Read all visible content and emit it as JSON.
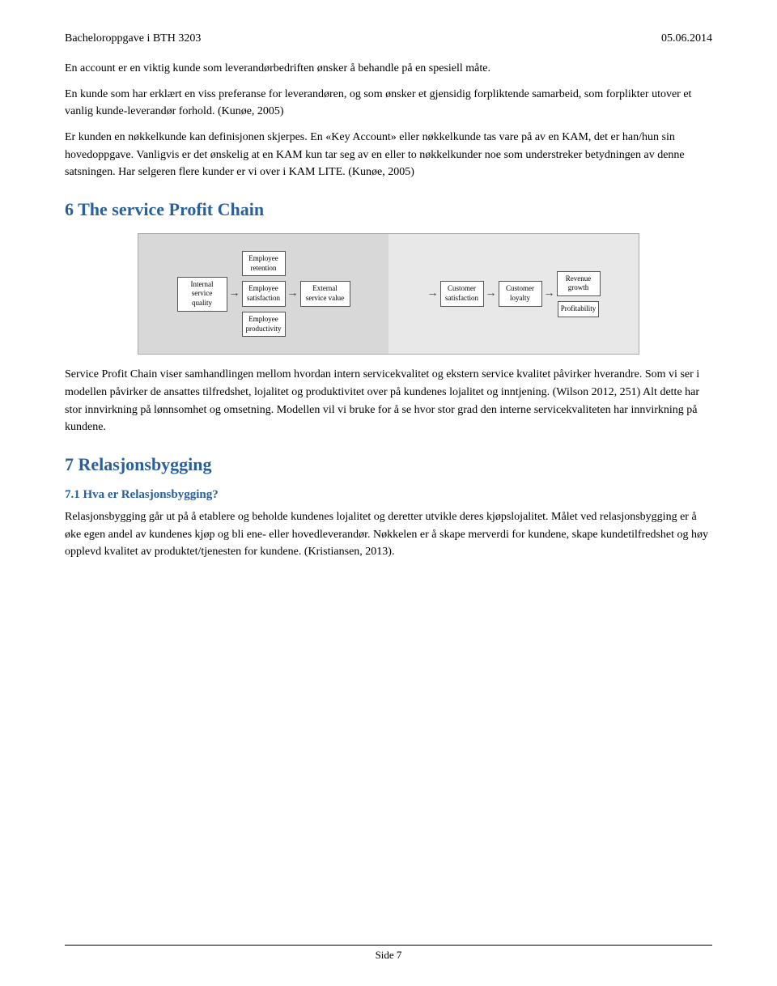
{
  "header": {
    "left": "Bacheloroppgave i BTH 3203",
    "right": "05.06.2014"
  },
  "paragraphs": {
    "p1": "En account er en viktig kunde som leverandørbedriften ønsker å behandle på en spesiell måte.",
    "p2": "En kunde som har erklært en viss preferanse for leverandøren, og som ønsker et gjensidig forpliktende samarbeid, som forplikter utover et vanlig kunde-leverandør forhold. (Kunøe, 2005)",
    "p3": "Er kunden en nøkkelkunde kan definisjonen skjerpes. En «Key Account» eller nøkkelkunde tas vare på av en KAM, det er han/hun sin hovedoppgave. Vanligvis er det ønskelig at en KAM kun tar seg av en eller to nøkkelkunder noe som understreker betydningen av denne satsningen. Har selgeren flere kunder er vi over i KAM LITE. (Kunøe, 2005)"
  },
  "section6": {
    "heading": "6   The service Profit Chain",
    "diagram": {
      "boxes_left": [
        "Internal service quality",
        "Employee satisfaction",
        "Employee retention",
        "Employee productivity"
      ],
      "middle": "External service value",
      "boxes_right": [
        "Customer satisfaction",
        "Customer loyalty",
        "Revenue growth",
        "Profitability"
      ]
    },
    "text1": "Service Profit Chain viser samhandlingen mellom hvordan intern servicekvalitet og ekstern service kvalitet påvirker hverandre. Som vi ser i modellen påvirker de ansattes tilfredshet, lojalitet og produktivitet over på kundenes lojalitet og inntjening. (Wilson 2012, 251) Alt dette har stor innvirkning på lønnsomhet og omsetning. Modellen vil vi bruke for å se hvor stor grad den interne servicekvaliteten har innvirkning på kundene."
  },
  "section7": {
    "heading": "7   Relasjonsbygging",
    "sub": "7.1   Hva er Relasjonsbygging?",
    "text1": "Relasjonsbygging går ut på å etablere og beholde kundenes lojalitet og deretter utvikle deres kjøpslojalitet. Målet ved relasjonsbygging er å øke egen andel av kundenes kjøp og bli ene- eller hovedleverandør. Nøkkelen er å skape merverdi for kundene, skape kundetilfredshet og høy opplevd kvalitet av produktet/tjenesten for kundene. (Kristiansen, 2013)."
  },
  "footer": {
    "label": "Side 7"
  }
}
